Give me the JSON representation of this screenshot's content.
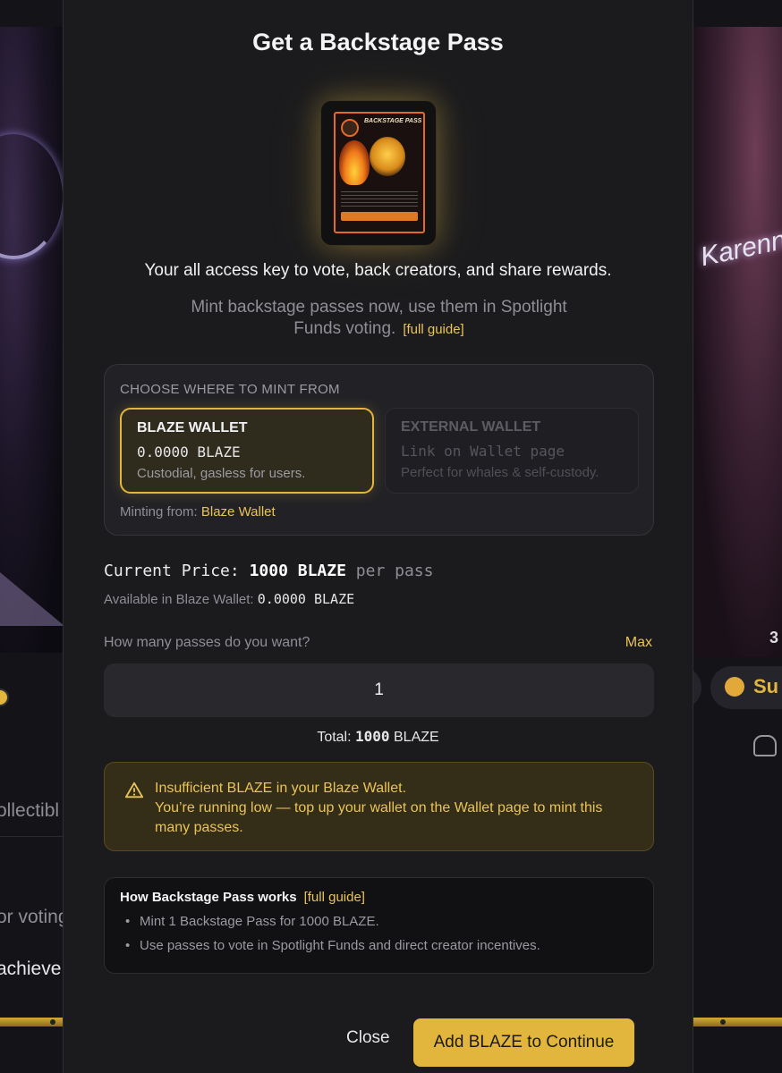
{
  "modal": {
    "title": "Get a Backstage Pass",
    "card_title": "BACKSTAGE PASS",
    "tagline": "Your all access key to vote, back creators, and share rewards.",
    "subtitle": "Mint backstage passes now, use them in Spotlight Funds voting.",
    "subtitle_link": "[full guide]"
  },
  "mint": {
    "heading": "CHOOSE WHERE TO MINT FROM",
    "options": [
      {
        "name": "BLAZE WALLET",
        "value": "0.0000 BLAZE",
        "desc": "Custodial, gasless for users."
      },
      {
        "name": "EXTERNAL WALLET",
        "value": "Link on Wallet page",
        "desc": "Perfect for whales & self-custody."
      }
    ],
    "minting_from_label": "Minting from:",
    "minting_from_value": "Blaze Wallet"
  },
  "price": {
    "label": "Current Price:",
    "value": "1000 BLAZE",
    "unit": "per pass",
    "available_label": "Available in Blaze Wallet:",
    "available_value": "0.0000 BLAZE"
  },
  "quantity": {
    "label": "How many passes do you want?",
    "max_label": "Max",
    "value": "1",
    "total_label": "Total:",
    "total_value": "1000",
    "total_unit": "BLAZE"
  },
  "warning": {
    "title": "Insufficient BLAZE in your Blaze Wallet.",
    "body": "You’re running low — top up your wallet on the Wallet page to mint this many passes."
  },
  "how": {
    "title": "How Backstage Pass works",
    "link": "[full guide]",
    "items": [
      "Mint 1 Backstage Pass for 1000 BLAZE.",
      "Use passes to vote in Spotlight Funds and direct creator incentives."
    ]
  },
  "footer": {
    "close_label": "Close",
    "cta_label": "Add BLAZE to Continue"
  },
  "background": {
    "left_text_1": "ollectibl",
    "left_text_2": "or voting",
    "left_text_3": "achieve",
    "right_sub": "Su",
    "right_num": "3",
    "right_script": "Karenn"
  },
  "colors": {
    "accent": "#e2b63c",
    "modal_bg": "#1b1b1e",
    "warning_bg": "#342d18"
  }
}
